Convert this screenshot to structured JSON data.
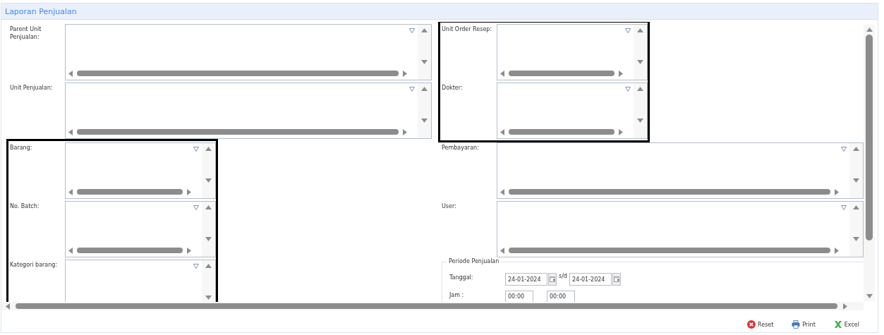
{
  "header": {
    "title": "Laporan Penjualan"
  },
  "left_column": [
    {
      "highlighted": false,
      "fields": [
        {
          "label": "Parent Unit Penjualan:",
          "kind": "wide"
        },
        {
          "label": "Unit Penjualan:",
          "kind": "wide"
        }
      ]
    },
    {
      "highlighted": true,
      "fields": [
        {
          "label": "Barang:",
          "kind": "narrow"
        },
        {
          "label": "No. Batch:",
          "kind": "narrow"
        },
        {
          "label": "Kategori barang:",
          "kind": "narrow"
        }
      ]
    }
  ],
  "right_column": [
    {
      "highlighted": true,
      "fields": [
        {
          "label": "Unit Order Resep:",
          "kind": "narrow"
        },
        {
          "label": "Dokter:",
          "kind": "narrow"
        }
      ]
    },
    {
      "highlighted": false,
      "fields": [
        {
          "label": "Pembayaran:",
          "kind": "wide"
        },
        {
          "label": "User:",
          "kind": "wide"
        }
      ]
    }
  ],
  "periode": {
    "legend": "Periode Penjualan",
    "rows": [
      {
        "kind": "date",
        "label": "Tanggal:",
        "from": "24-01-2024",
        "separator": "s/d",
        "to": "24-01-2024"
      },
      {
        "kind": "time",
        "label": "Jam :",
        "from": "00:00",
        "to": "00:00"
      }
    ]
  },
  "buttons": [
    {
      "kind": "reset",
      "label": "Reset"
    },
    {
      "kind": "print",
      "label": "Print"
    },
    {
      "kind": "excel",
      "label": "Excel"
    }
  ]
}
